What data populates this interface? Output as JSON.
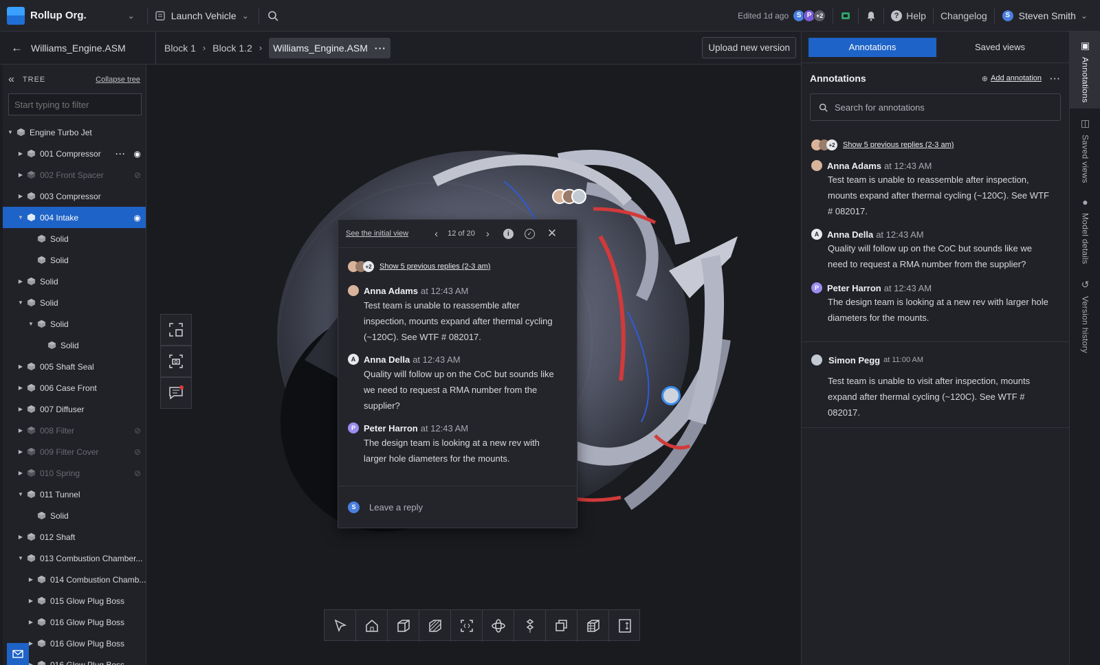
{
  "topbar": {
    "org_name": "Rollup Org.",
    "project": "Launch Vehicle",
    "edited": "Edited 1d ago",
    "avatars": [
      {
        "letter": "S",
        "color": "#4a7fe0"
      },
      {
        "letter": "P",
        "color": "#7a5cd6"
      },
      {
        "letter": "+2",
        "color": "#5a5b63"
      }
    ],
    "help": "Help",
    "changelog": "Changelog",
    "user_initial": "S",
    "user_name": "Steven Smith"
  },
  "subbar": {
    "back_title": "Williams_Engine.ASM",
    "crumbs": [
      "Block 1",
      "Block 1.2"
    ],
    "active_crumb": "Williams_Engine.ASM",
    "upload_label": "Upload new version"
  },
  "tree": {
    "title": "TREE",
    "collapse_label": "Collapse tree",
    "filter_placeholder": "Start typing to filter",
    "rows": [
      {
        "label": "Engine Turbo Jet",
        "caret": "▼",
        "level": 0,
        "dim": false,
        "selected": false,
        "eye": ""
      },
      {
        "label": "001 Compressor",
        "caret": "▶",
        "level": 1,
        "dim": false,
        "selected": false,
        "eye": "visible",
        "more": true
      },
      {
        "label": "002 Front Spacer",
        "caret": "▶",
        "level": 1,
        "dim": true,
        "selected": false,
        "eye": "hidden"
      },
      {
        "label": "003 Compressor",
        "caret": "▶",
        "level": 1,
        "dim": false,
        "selected": false,
        "eye": ""
      },
      {
        "label": "004 Intake",
        "caret": "▼",
        "level": 1,
        "dim": false,
        "selected": true,
        "eye": "visible"
      },
      {
        "label": "Solid",
        "caret": "",
        "level": 2,
        "dim": false,
        "selected": false,
        "eye": ""
      },
      {
        "label": "Solid",
        "caret": "",
        "level": 2,
        "dim": false,
        "selected": false,
        "eye": ""
      },
      {
        "label": "Solid",
        "caret": "▶",
        "level": 1,
        "dim": false,
        "selected": false,
        "eye": ""
      },
      {
        "label": "Solid",
        "caret": "▼",
        "level": 1,
        "dim": false,
        "selected": false,
        "eye": ""
      },
      {
        "label": "Solid",
        "caret": "▼",
        "level": 2,
        "dim": false,
        "selected": false,
        "eye": ""
      },
      {
        "label": "Solid",
        "caret": "",
        "level": 3,
        "dim": false,
        "selected": false,
        "eye": ""
      },
      {
        "label": "005 Shaft Seal",
        "caret": "▶",
        "level": 1,
        "dim": false,
        "selected": false,
        "eye": ""
      },
      {
        "label": "006 Case Front",
        "caret": "▶",
        "level": 1,
        "dim": false,
        "selected": false,
        "eye": ""
      },
      {
        "label": "007 Diffuser",
        "caret": "▶",
        "level": 1,
        "dim": false,
        "selected": false,
        "eye": ""
      },
      {
        "label": "008 Filter",
        "caret": "▶",
        "level": 1,
        "dim": true,
        "selected": false,
        "eye": "hidden"
      },
      {
        "label": "009 Filter Cover",
        "caret": "▶",
        "level": 1,
        "dim": true,
        "selected": false,
        "eye": "hidden"
      },
      {
        "label": "010 Spring",
        "caret": "▶",
        "level": 1,
        "dim": true,
        "selected": false,
        "eye": "hidden"
      },
      {
        "label": "011 Tunnel",
        "caret": "▼",
        "level": 1,
        "dim": false,
        "selected": false,
        "eye": ""
      },
      {
        "label": "Solid",
        "caret": "",
        "level": 2,
        "dim": false,
        "selected": false,
        "eye": ""
      },
      {
        "label": "012 Shaft",
        "caret": "▶",
        "level": 1,
        "dim": false,
        "selected": false,
        "eye": ""
      },
      {
        "label": "013 Combustion Chamber...",
        "caret": "▼",
        "level": 1,
        "dim": false,
        "selected": false,
        "eye": ""
      },
      {
        "label": "014 Combustion Chamb...",
        "caret": "▶",
        "level": 2,
        "dim": false,
        "selected": false,
        "eye": ""
      },
      {
        "label": "015 Glow Plug Boss",
        "caret": "▶",
        "level": 2,
        "dim": false,
        "selected": false,
        "eye": ""
      },
      {
        "label": "016 Glow Plug Boss",
        "caret": "▶",
        "level": 2,
        "dim": false,
        "selected": false,
        "eye": ""
      },
      {
        "label": "016 Glow Plug Boss",
        "caret": "▶",
        "level": 2,
        "dim": false,
        "selected": false,
        "eye": ""
      },
      {
        "label": "016 Glow Plug Boss",
        "caret": "▶",
        "level": 2,
        "dim": false,
        "selected": false,
        "eye": ""
      }
    ]
  },
  "popup": {
    "initial_view_link": "See the initial view",
    "pager": "12 of 20",
    "show_replies": "Show 5 previous replies (2-3 am)",
    "messages": [
      {
        "name": "Anna Adams",
        "time": "at 12:43 AM",
        "avatar": "photo",
        "lines": [
          "Test team is unable to reassemble after",
          "inspection, mounts expand after thermal cycling",
          "(~120C). See WTF # 082017."
        ]
      },
      {
        "name": "Anna Della",
        "time": "at 12:43 AM",
        "avatar": "A",
        "lines": [
          "Quality will follow up on the CoC but sounds like",
          "we need to request a RMA number from the",
          "supplier?"
        ]
      },
      {
        "name": "Peter Harron",
        "time": "at 12:43 AM",
        "avatar": "P",
        "lines": [
          "The design team is looking at a new rev with",
          "larger hole diameters for the mounts."
        ]
      }
    ],
    "reply_initial": "S",
    "reply_placeholder": "Leave a reply"
  },
  "right_panel": {
    "tab_active": "Annotations",
    "tab_inactive": "Saved views",
    "title": "Annotations",
    "add_label": "Add annotation",
    "search_placeholder": "Search for annotations",
    "show_replies": "Show 5 previous replies (2-3 am)",
    "thread": [
      {
        "name": "Anna Adams",
        "time": "at 12:43 AM",
        "avatar": "photo",
        "lines": [
          "Test team is unable to reassemble after inspection,",
          "mounts expand after thermal cycling (~120C). See WTF",
          "# 082017."
        ]
      },
      {
        "name": "Anna Della",
        "time": "at 12:43 AM",
        "avatar": "A",
        "lines": [
          "Quality will follow up on the CoC but sounds like we",
          "need to request a RMA number from the supplier?"
        ]
      },
      {
        "name": "Peter Harron",
        "time": "at 12:43 AM",
        "avatar": "P",
        "lines": [
          "The design team is looking at a new rev with larger hole",
          "diameters for the mounts."
        ]
      }
    ],
    "second": {
      "name": "Simon Pegg",
      "time": "at 11:00 AM",
      "lines": [
        "Test team is unable to visit after inspection, mounts",
        "expand after thermal cycling (~120C). See WTF #",
        "082017."
      ]
    }
  },
  "rail": {
    "items": [
      "Annotations",
      "Saved views",
      "Model details",
      "Version history"
    ]
  },
  "colors": {
    "accent": "#1e63c7",
    "accent_light": "#4a8ff0"
  }
}
